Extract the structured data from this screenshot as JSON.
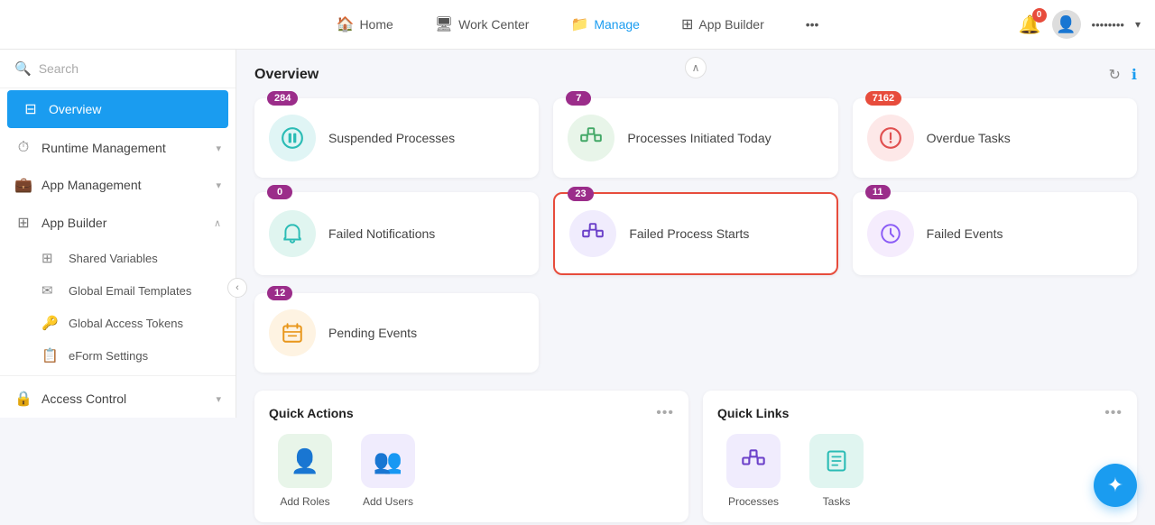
{
  "nav": {
    "links": [
      {
        "id": "home",
        "label": "Home",
        "icon": "🏠",
        "active": false
      },
      {
        "id": "work-center",
        "label": "Work Center",
        "icon": "🖥",
        "active": false
      },
      {
        "id": "manage",
        "label": "Manage",
        "icon": "📁",
        "active": true
      },
      {
        "id": "app-builder",
        "label": "App Builder",
        "icon": "⊞",
        "active": false
      }
    ],
    "dots": "•••",
    "bell_badge": "0",
    "username": "••••••••",
    "chevron": "▾"
  },
  "sidebar": {
    "search_placeholder": "Search",
    "items": [
      {
        "id": "overview",
        "label": "Overview",
        "icon": "⊟",
        "active": true,
        "chevron": false
      },
      {
        "id": "runtime-management",
        "label": "Runtime Management",
        "icon": "⏱",
        "active": false,
        "chevron": true
      },
      {
        "id": "app-management",
        "label": "App Management",
        "icon": "💼",
        "active": false,
        "chevron": true
      },
      {
        "id": "app-builder",
        "label": "App Builder",
        "icon": "⊞",
        "active": false,
        "chevron": true,
        "expanded": true
      }
    ],
    "sub_items": [
      {
        "id": "shared-variables",
        "label": "Shared Variables",
        "icon": "⊞"
      },
      {
        "id": "global-email-templates",
        "label": "Global Email Templates",
        "icon": "✉"
      },
      {
        "id": "global-access-tokens",
        "label": "Global Access Tokens",
        "icon": "🔑"
      },
      {
        "id": "eform-settings",
        "label": "eForm Settings",
        "icon": "📋"
      }
    ],
    "bottom_items": [
      {
        "id": "access-control",
        "label": "Access Control",
        "icon": "🔒",
        "chevron": true
      }
    ]
  },
  "content": {
    "title": "Overview",
    "refresh_icon": "↻",
    "info_icon": "ℹ",
    "collapse_icon": "∧",
    "stats": [
      {
        "id": "suspended-processes",
        "label": "Suspended Processes",
        "badge": "284",
        "badge_color": "purple",
        "icon": "⏸",
        "icon_style": "teal",
        "highlighted": false
      },
      {
        "id": "processes-initiated-today",
        "label": "Processes Initiated Today",
        "badge": "7",
        "badge_color": "purple",
        "icon": "⊞",
        "icon_style": "green",
        "highlighted": false
      },
      {
        "id": "overdue-tasks",
        "label": "Overdue Tasks",
        "badge": "7162",
        "badge_color": "red",
        "icon": "⚠",
        "icon_style": "pink",
        "highlighted": false
      },
      {
        "id": "failed-notifications",
        "label": "Failed Notifications",
        "badge": "0",
        "badge_color": "purple",
        "icon": "🔔",
        "icon_style": "mint",
        "highlighted": false
      },
      {
        "id": "failed-process-starts",
        "label": "Failed Process Starts",
        "badge": "23",
        "badge_color": "purple",
        "icon": "⊞",
        "icon_style": "purple",
        "highlighted": true
      },
      {
        "id": "failed-events",
        "label": "Failed Events",
        "badge": "11",
        "badge_color": "purple",
        "icon": "🕐",
        "icon_style": "lavender",
        "highlighted": false
      },
      {
        "id": "pending-events",
        "label": "Pending Events",
        "badge": "12",
        "badge_color": "purple",
        "icon": "📋",
        "icon_style": "orange",
        "highlighted": false
      }
    ],
    "quick_actions": {
      "title": "Quick Actions",
      "dots": "•••",
      "items": [
        {
          "id": "add-roles",
          "label": "Add Roles",
          "icon": "👤",
          "icon_style": "green"
        },
        {
          "id": "add-users",
          "label": "Add Users",
          "icon": "👥",
          "icon_style": "purple"
        }
      ]
    },
    "quick_links": {
      "title": "Quick Links",
      "dots": "•••",
      "items": [
        {
          "id": "processes",
          "label": "Processes",
          "icon": "⊞",
          "icon_style": "purple"
        },
        {
          "id": "tasks",
          "label": "Tasks",
          "icon": "📋",
          "icon_style": "teal"
        }
      ]
    }
  }
}
